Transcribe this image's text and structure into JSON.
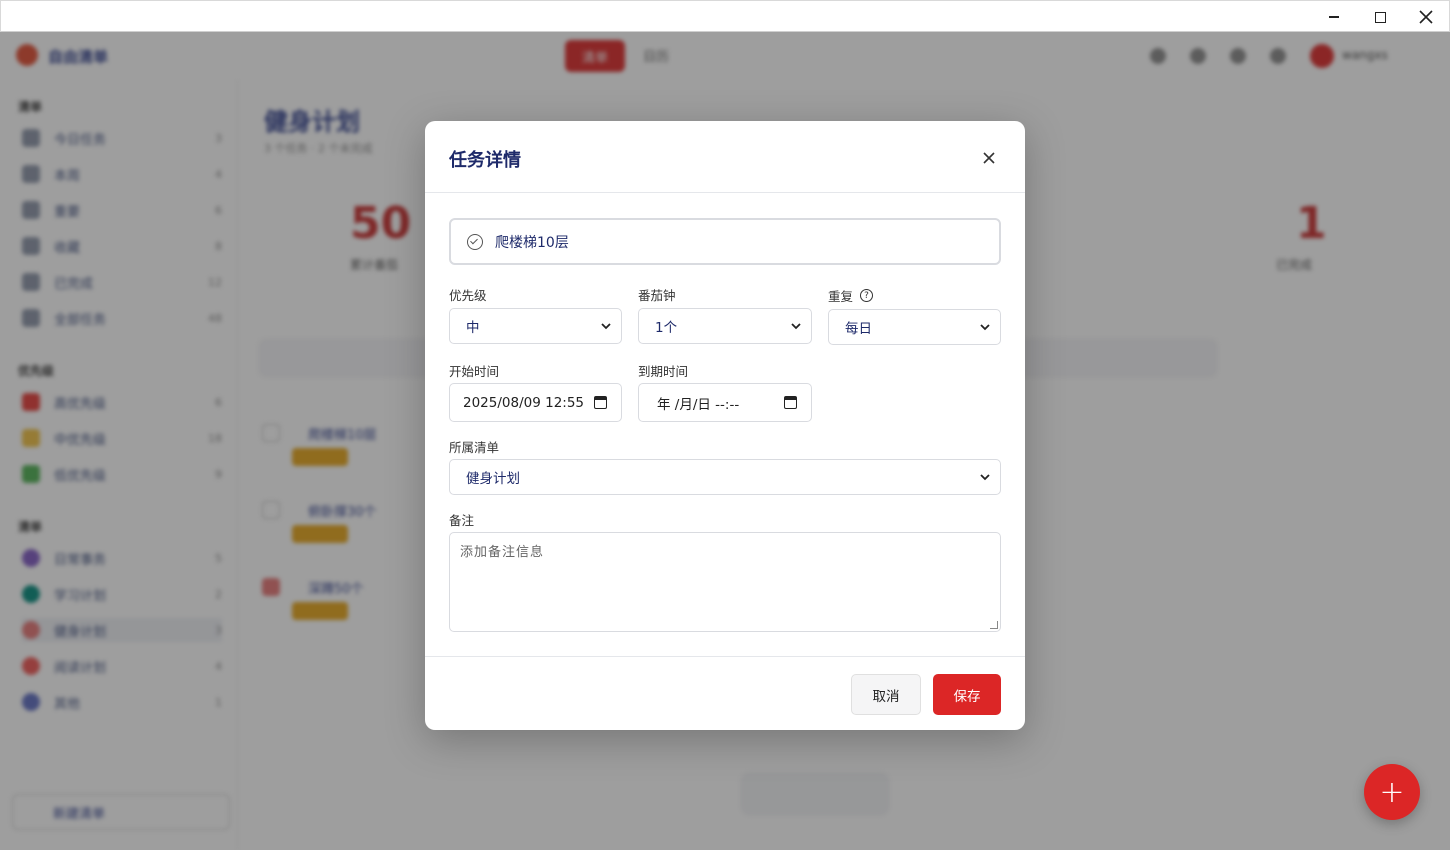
{
  "background": {
    "app_name": "自由清单",
    "nav_tabs": [
      "清单",
      "日历"
    ],
    "username": "wangxs",
    "sidebar_sections": [
      {
        "title": "清单",
        "items": [
          {
            "label": "今日任务",
            "count": "3"
          },
          {
            "label": "本周",
            "count": "4"
          },
          {
            "label": "重要",
            "count": "6"
          },
          {
            "label": "收藏",
            "count": "8"
          },
          {
            "label": "已完成",
            "count": "12"
          },
          {
            "label": "全部任务",
            "count": "48"
          }
        ]
      },
      {
        "title": "优先级",
        "items": [
          {
            "label": "高优先级",
            "count": "6"
          },
          {
            "label": "中优先级",
            "count": "18"
          },
          {
            "label": "低优先级",
            "count": "9"
          }
        ]
      },
      {
        "title": "清单",
        "items": [
          {
            "label": "日常事务",
            "count": "5"
          },
          {
            "label": "学习计划",
            "count": "2"
          },
          {
            "label": "健身计划",
            "count": "3"
          },
          {
            "label": "阅读计划",
            "count": "4"
          },
          {
            "label": "其他",
            "count": "1"
          }
        ]
      }
    ],
    "add_list_label": "新建清单",
    "page_title": "健身计划",
    "page_subtitle": "3 个任务 · 2 个未完成",
    "stats": [
      {
        "num": "50",
        "label": "累计番茄"
      },
      {
        "num": "1",
        "label": "已完成"
      }
    ],
    "tasks": [
      "爬楼梯10层",
      "俯卧撑30个",
      "深蹲50个"
    ]
  },
  "modal": {
    "title": "任务详情",
    "close_icon": "×",
    "task_name": "爬楼梯10层",
    "priority": {
      "label": "优先级",
      "value": "中"
    },
    "pomodoro": {
      "label": "番茄钟",
      "value": "1个"
    },
    "repeat": {
      "label": "重复",
      "value": "每日",
      "help": "?"
    },
    "start_time": {
      "label": "开始时间",
      "value": "2025/08/09 12:55"
    },
    "due_time": {
      "label": "到期时间",
      "value": "年 /月/日 --:--"
    },
    "list": {
      "label": "所属清单",
      "value": "健身计划"
    },
    "notes": {
      "label": "备注",
      "placeholder": "添加备注信息"
    },
    "cancel_label": "取消",
    "save_label": "保存"
  },
  "fab_label": "+",
  "colors": {
    "accent": "#dc2626",
    "title": "#1e2a6a"
  }
}
